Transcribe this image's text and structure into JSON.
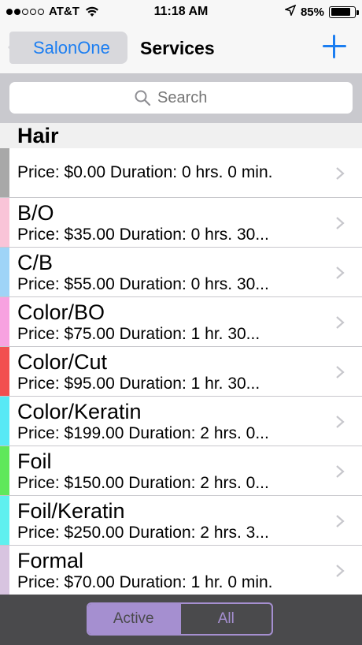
{
  "status_bar": {
    "carrier": "AT&T",
    "time": "11:18 AM",
    "battery_percent": "85%",
    "battery_level": 0.85,
    "signal_bars_filled": 2,
    "signal_bars_total": 5
  },
  "nav": {
    "back_label": "SalonOne",
    "title": "Services",
    "add_icon": "plus-icon"
  },
  "search": {
    "placeholder": "Search"
  },
  "section": {
    "title": "Hair"
  },
  "services": [
    {
      "name": "",
      "detail": "Price: $0.00  Duration: 0 hrs. 0 min.",
      "color": "#a8a8a8"
    },
    {
      "name": "B/O",
      "detail": "Price: $35.00  Duration: 0 hrs. 30...",
      "color": "#f9c4d8"
    },
    {
      "name": "C/B",
      "detail": "Price: $55.00  Duration: 0 hrs. 30...",
      "color": "#9fd4f7"
    },
    {
      "name": "Color/BO",
      "detail": "Price: $75.00  Duration: 1 hr. 30...",
      "color": "#f7a2e0"
    },
    {
      "name": "Color/Cut",
      "detail": "Price: $95.00  Duration: 1 hr. 30...",
      "color": "#f24f4f"
    },
    {
      "name": "Color/Keratin",
      "detail": "Price: $199.00  Duration: 2 hrs. 0...",
      "color": "#58e9f5"
    },
    {
      "name": "Foil",
      "detail": "Price: $150.00  Duration: 2 hrs. 0...",
      "color": "#5fe85a"
    },
    {
      "name": "Foil/Keratin",
      "detail": "Price: $250.00  Duration: 2 hrs. 3...",
      "color": "#5ff0ef"
    },
    {
      "name": "Formal",
      "detail": "Price: $70.00  Duration: 1 hr. 0 min.",
      "color": "#d8c4e0"
    }
  ],
  "toolbar": {
    "active_label": "Active",
    "all_label": "All",
    "accent": "#a58fd0"
  }
}
